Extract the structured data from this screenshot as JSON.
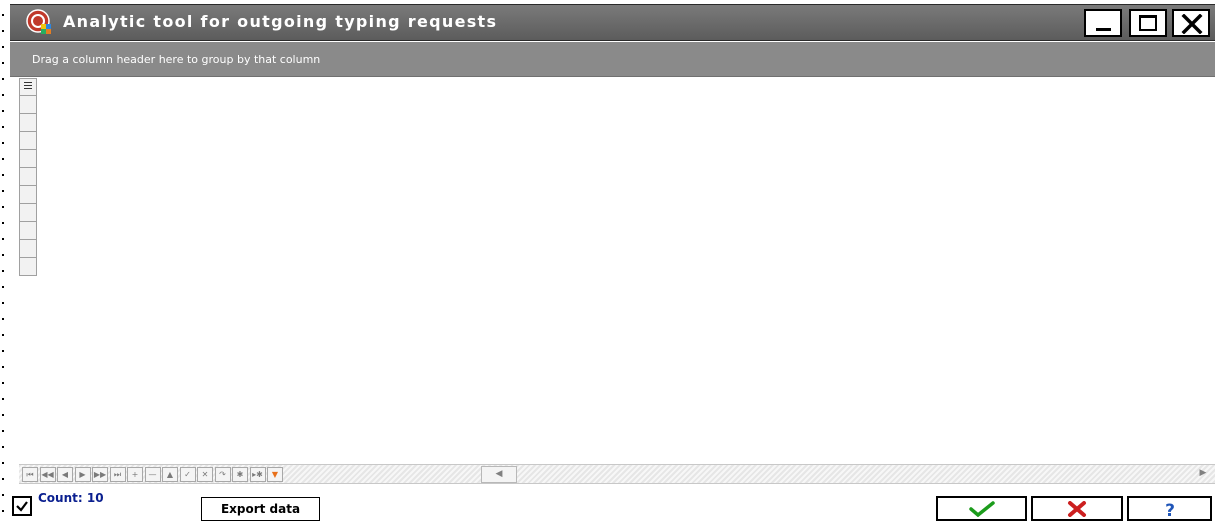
{
  "window": {
    "title": "Analytic tool for outgoing typing requests",
    "icon": "app-logo-icon",
    "controls": {
      "minimize_icon": "minimize-icon",
      "maximize_icon": "maximize-icon",
      "close_icon": "close-icon"
    }
  },
  "grid": {
    "group_panel_hint": "Drag a column header here to group by that column",
    "row_count_visible": 11,
    "navigator": {
      "buttons": [
        {
          "name": "first-icon",
          "glyph": "⏮"
        },
        {
          "name": "prev-page-icon",
          "glyph": "◀◀"
        },
        {
          "name": "prev-icon",
          "glyph": "◀"
        },
        {
          "name": "next-icon",
          "glyph": "▶"
        },
        {
          "name": "next-page-icon",
          "glyph": "▶▶"
        },
        {
          "name": "last-icon",
          "glyph": "⏭"
        },
        {
          "name": "insert-icon",
          "glyph": "+"
        },
        {
          "name": "delete-icon",
          "glyph": "—"
        },
        {
          "name": "edit-icon",
          "glyph": "▲"
        },
        {
          "name": "post-icon",
          "glyph": "✓"
        },
        {
          "name": "cancel-edit-icon",
          "glyph": "✕"
        },
        {
          "name": "refresh-icon",
          "glyph": "↷"
        },
        {
          "name": "bookmark-icon",
          "glyph": "✱"
        },
        {
          "name": "goto-bookmark-icon",
          "glyph": "▸✱"
        },
        {
          "name": "filter-icon",
          "glyph": "▼"
        }
      ]
    }
  },
  "footer": {
    "count_label": "Count: 10",
    "export_label": "Export data",
    "ok_icon": "checkmark-icon",
    "cancel_icon": "red-x-icon",
    "help_icon": "question-mark-icon",
    "colors": {
      "count_text": "#0a1f8f",
      "ok_green": "#1c9c1c",
      "cancel_red": "#cc1f1f",
      "help_blue": "#1f55b8"
    }
  }
}
